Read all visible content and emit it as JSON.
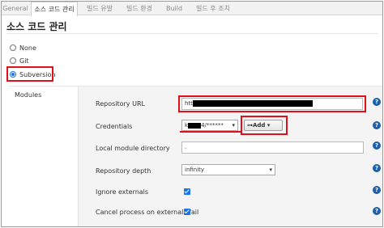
{
  "tabs": [
    {
      "label": "General"
    },
    {
      "label": "소스 코드 관리"
    },
    {
      "label": "빌드 유발"
    },
    {
      "label": "빌드 환경"
    },
    {
      "label": "Build"
    },
    {
      "label": "빌드 후 조치"
    }
  ],
  "section_title": "소스 코드 관리",
  "scm_options": [
    {
      "label": "None",
      "selected": false
    },
    {
      "label": "Git",
      "selected": false
    },
    {
      "label": "Subversion",
      "selected": true
    }
  ],
  "modules_label": "Modules",
  "fields": {
    "repository_url": {
      "label": "Repository URL",
      "value_prefix": "htt"
    },
    "credentials": {
      "label": "Credentials",
      "value_prefix": "k",
      "value_suffix": "4/******",
      "add_label": "Add"
    },
    "local_module_directory": {
      "label": "Local module directory",
      "value": "."
    },
    "repository_depth": {
      "label": "Repository depth",
      "value": "infinity"
    },
    "ignore_externals": {
      "label": "Ignore externals",
      "checked": true
    },
    "cancel_process": {
      "label": "Cancel process on externals fail",
      "checked": true
    }
  },
  "help_symbol": "?",
  "colors": {
    "highlight": "#e0101a",
    "accent": "#1a73e8",
    "help": "#1d5fa8"
  }
}
